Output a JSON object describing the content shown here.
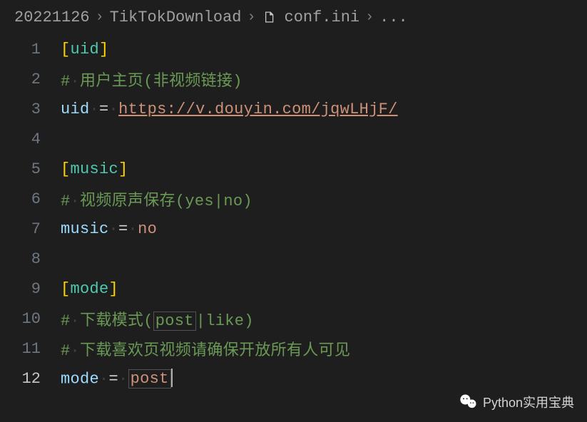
{
  "breadcrumb": {
    "item1": "20221126",
    "item2": "TikTokDownload",
    "item3": "conf.ini",
    "item4": "..."
  },
  "lines": {
    "l1": {
      "num": "1",
      "section": "uid"
    },
    "l2": {
      "num": "2",
      "comment": "用户主页(非视频链接)"
    },
    "l3": {
      "num": "3",
      "key": "uid",
      "value": "https://v.douyin.com/jqwLHjF/"
    },
    "l4": {
      "num": "4"
    },
    "l5": {
      "num": "5",
      "section": "music"
    },
    "l6": {
      "num": "6",
      "comment": "视频原声保存(yes|no)"
    },
    "l7": {
      "num": "7",
      "key": "music",
      "value": "no"
    },
    "l8": {
      "num": "8"
    },
    "l9": {
      "num": "9",
      "section": "mode"
    },
    "l10": {
      "num": "10",
      "comment_pre": "下载模式(",
      "hl": "post",
      "comment_post": "|like)"
    },
    "l11": {
      "num": "11",
      "comment": "下载喜欢页视频请确保开放所有人可见"
    },
    "l12": {
      "num": "12",
      "key": "mode",
      "value": "post"
    }
  },
  "watermark": {
    "text": "Python实用宝典"
  }
}
